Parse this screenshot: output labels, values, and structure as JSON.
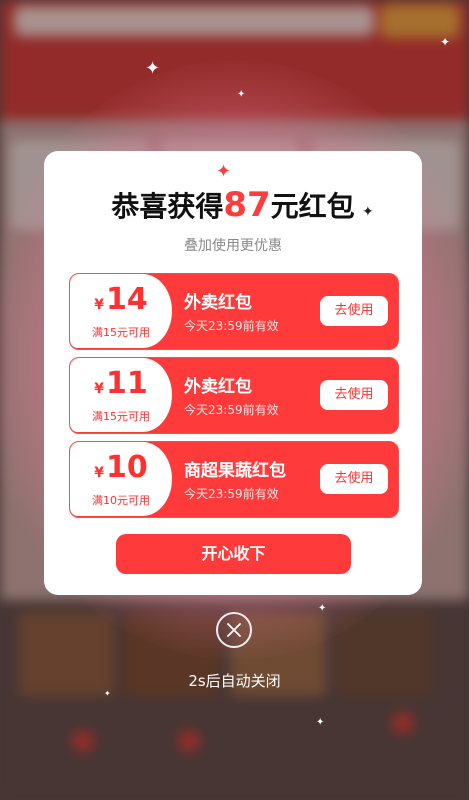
{
  "popup": {
    "title_prefix": "恭喜获得",
    "title_amount": "87",
    "title_suffix": "元红包",
    "subtitle": "叠加使用更优惠",
    "coupons": [
      {
        "currency": "¥",
        "amount": "14",
        "condition": "满15元可用",
        "name": "外卖红包",
        "expiry": "今天23:59前有效",
        "action": "去使用"
      },
      {
        "currency": "¥",
        "amount": "11",
        "condition": "满15元可用",
        "name": "外卖红包",
        "expiry": "今天23:59前有效",
        "action": "去使用"
      },
      {
        "currency": "¥",
        "amount": "10",
        "condition": "满10元可用",
        "name": "商超果蔬红包",
        "expiry": "今天23:59前有效",
        "action": "去使用"
      }
    ],
    "collect_button": "开心收下",
    "auto_close_text": "2s后自动关闭"
  },
  "icons": {
    "close": "close-icon",
    "sparkle": "sparkle-icon"
  },
  "colors": {
    "accent_red": "#ff3a3a",
    "card_bg": "#ffffff",
    "backdrop_glow": "#f4a6b8"
  }
}
